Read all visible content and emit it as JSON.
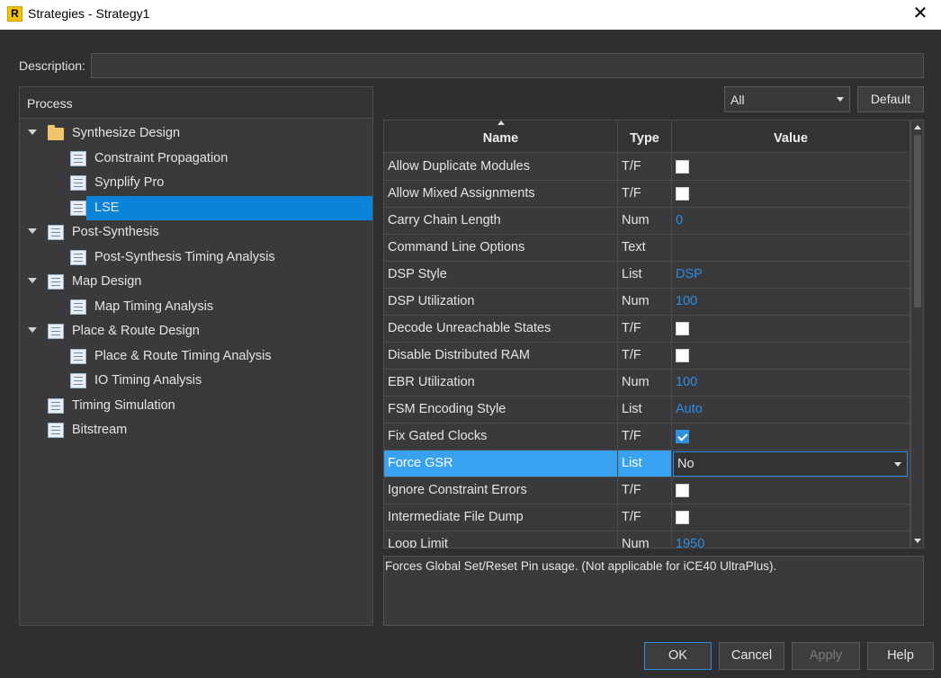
{
  "window": {
    "title": "Strategies - Strategy1",
    "app_icon_letter": "R",
    "close_glyph": "✕"
  },
  "description": {
    "label": "Description:",
    "value": ""
  },
  "process": {
    "header": "Process",
    "items": [
      {
        "label": "Synthesize Design",
        "level": 0,
        "icon": "folder-icon",
        "expanded": true,
        "selected": false
      },
      {
        "label": "Constraint Propagation",
        "level": 1,
        "icon": "list-doc-icon",
        "selected": false
      },
      {
        "label": "Synplify Pro",
        "level": 1,
        "icon": "list-doc-icon",
        "selected": false
      },
      {
        "label": "LSE",
        "level": 1,
        "icon": "list-doc-icon",
        "selected": true
      },
      {
        "label": "Post-Synthesis",
        "level": 0,
        "icon": "list-doc-icon",
        "expanded": true,
        "selected": false
      },
      {
        "label": "Post-Synthesis Timing Analysis",
        "level": 1,
        "icon": "list-doc-icon",
        "selected": false
      },
      {
        "label": "Map Design",
        "level": 0,
        "icon": "list-doc-icon",
        "expanded": true,
        "selected": false
      },
      {
        "label": "Map Timing Analysis",
        "level": 1,
        "icon": "list-doc-icon",
        "selected": false
      },
      {
        "label": "Place & Route Design",
        "level": 0,
        "icon": "list-doc-icon",
        "expanded": true,
        "selected": false
      },
      {
        "label": "Place & Route Timing Analysis",
        "level": 1,
        "icon": "list-doc-icon",
        "selected": false
      },
      {
        "label": "IO Timing Analysis",
        "level": 1,
        "icon": "list-doc-icon",
        "selected": false
      },
      {
        "label": "Timing Simulation",
        "level": 0,
        "icon": "list-doc-icon",
        "selected": false
      },
      {
        "label": "Bitstream",
        "level": 0,
        "icon": "list-doc-icon",
        "selected": false
      }
    ]
  },
  "filter": {
    "selected": "All",
    "default_button": "Default"
  },
  "grid": {
    "columns": [
      "Name",
      "Type",
      "Value"
    ],
    "rows": [
      {
        "name": "Allow Duplicate Modules",
        "type": "T/F",
        "kind": "checkbox",
        "checked": false
      },
      {
        "name": "Allow Mixed Assignments",
        "type": "T/F",
        "kind": "checkbox",
        "checked": false
      },
      {
        "name": "Carry Chain Length",
        "type": "Num",
        "kind": "text",
        "value": "0"
      },
      {
        "name": "Command Line Options",
        "type": "Text",
        "kind": "text",
        "value": ""
      },
      {
        "name": "DSP Style",
        "type": "List",
        "kind": "text",
        "value": "DSP"
      },
      {
        "name": "DSP Utilization",
        "type": "Num",
        "kind": "text",
        "value": "100"
      },
      {
        "name": "Decode Unreachable States",
        "type": "T/F",
        "kind": "checkbox",
        "checked": false
      },
      {
        "name": "Disable Distributed RAM",
        "type": "T/F",
        "kind": "checkbox",
        "checked": false
      },
      {
        "name": "EBR Utilization",
        "type": "Num",
        "kind": "text",
        "value": "100"
      },
      {
        "name": "FSM Encoding Style",
        "type": "List",
        "kind": "text",
        "value": "Auto"
      },
      {
        "name": "Fix Gated Clocks",
        "type": "T/F",
        "kind": "checkbox",
        "checked": true
      },
      {
        "name": "Force GSR",
        "type": "List",
        "kind": "select",
        "value": "No",
        "highlight": true
      },
      {
        "name": "Ignore Constraint Errors",
        "type": "T/F",
        "kind": "checkbox",
        "checked": false
      },
      {
        "name": "Intermediate File Dump",
        "type": "T/F",
        "kind": "checkbox",
        "checked": false
      },
      {
        "name": "Loop Limit",
        "type": "Num",
        "kind": "text",
        "value": "1950"
      }
    ]
  },
  "help_text": "Forces Global Set/Reset Pin usage. (Not applicable for iCE40 UltraPlus).",
  "buttons": {
    "ok": "OK",
    "cancel": "Cancel",
    "apply": "Apply",
    "help": "Help"
  },
  "colors": {
    "selection": "#0a84d8",
    "highlight": "#39a2f0",
    "value_blue": "#2b8de0"
  }
}
